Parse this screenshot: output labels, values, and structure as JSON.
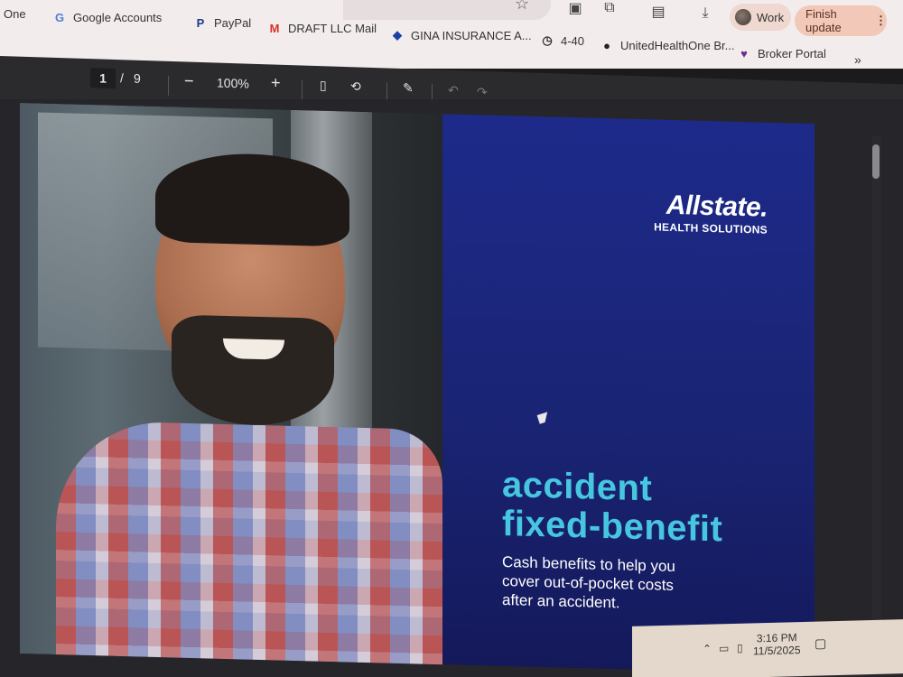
{
  "bookmarks": [
    {
      "label": "One",
      "icon": "bookmark-icon"
    },
    {
      "label": "Google Accounts",
      "icon": "google-icon"
    },
    {
      "label": "PayPal",
      "icon": "paypal-icon"
    },
    {
      "label": "DRAFT LLC Mail",
      "icon": "gmail-icon"
    },
    {
      "label": "GINA INSURANCE A...",
      "icon": "diamond-icon"
    },
    {
      "label": "4-40",
      "icon": "clock-icon"
    },
    {
      "label": "UnitedHealthOne Br...",
      "icon": "globe-icon"
    },
    {
      "label": "Broker Portal",
      "icon": "heart-icon"
    }
  ],
  "profile": {
    "label": "Work"
  },
  "update_button": {
    "label": "Finish update"
  },
  "pdf_toolbar": {
    "page_current": "1",
    "page_separator": "/",
    "page_total": "9",
    "zoom": "100%",
    "zoom_out_symbol": "−",
    "zoom_in_symbol": "+"
  },
  "document": {
    "logo_name": "Allstate.",
    "logo_sub": "HEALTH SOLUTIONS",
    "title_line1": "accident",
    "title_line2": "fixed-benefit",
    "subtitle_line1": "Cash benefits to help you",
    "subtitle_line2": "cover out-of-pocket costs",
    "subtitle_line3": "after an accident."
  },
  "taskbar": {
    "time": "3:16 PM",
    "date": "11/5/2025"
  },
  "colors": {
    "accent_title": "#47c6e0",
    "panel_blue": "#1d2a8a",
    "update_button": "#f2c9b8"
  }
}
